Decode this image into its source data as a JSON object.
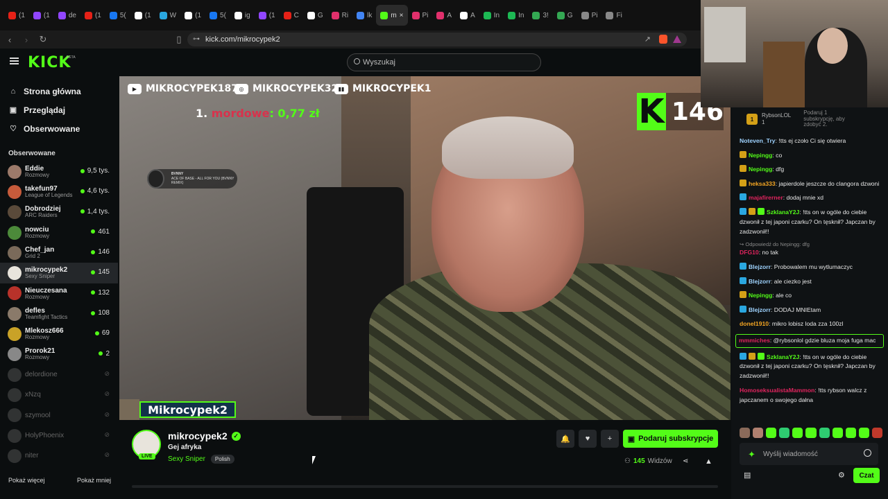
{
  "browser": {
    "tabs": [
      {
        "label": "(1",
        "color": "#e62117"
      },
      {
        "label": "(1",
        "color": "#9146ff"
      },
      {
        "label": "de",
        "color": "#9146ff"
      },
      {
        "label": "(1",
        "color": "#e62117"
      },
      {
        "label": "5(",
        "color": "#1877f2"
      },
      {
        "label": "(1",
        "color": "#ffffff"
      },
      {
        "label": "W",
        "color": "#2aa7e0"
      },
      {
        "label": "(1",
        "color": "#ffffff"
      },
      {
        "label": "5(",
        "color": "#1877f2"
      },
      {
        "label": "ig",
        "color": "#ffffff"
      },
      {
        "label": "(1",
        "color": "#9146ff"
      },
      {
        "label": "C",
        "color": "#e62117"
      },
      {
        "label": "G",
        "color": "#ffffff"
      },
      {
        "label": "Ri",
        "color": "#e1306c"
      },
      {
        "label": "lk",
        "color": "#4285f4"
      },
      {
        "label": "m",
        "color": "#53fc18",
        "active": true
      },
      {
        "label": "Pi",
        "color": "#e1306c"
      },
      {
        "label": "A",
        "color": "#e1306c"
      },
      {
        "label": "A",
        "color": "#ffffff"
      },
      {
        "label": "In",
        "color": "#1db954"
      },
      {
        "label": "In",
        "color": "#1db954"
      },
      {
        "label": "3!",
        "color": "#34a853"
      },
      {
        "label": "G",
        "color": "#34a853"
      },
      {
        "label": "Pi",
        "color": "#888888"
      },
      {
        "label": "Fi",
        "color": "#888888"
      }
    ],
    "close_glyph": "×",
    "url": "kick.com/mikrocypek2"
  },
  "header": {
    "logo": "KICK",
    "logo_beta": "BETA",
    "search_placeholder": "Wyszukaj"
  },
  "sidebar": {
    "nav": [
      {
        "label": "Strona główna",
        "icon": "home-icon",
        "glyph": "⌂"
      },
      {
        "label": "Przeglądaj",
        "icon": "browse-icon",
        "glyph": "▣"
      },
      {
        "label": "Obserwowane",
        "icon": "heart-icon",
        "glyph": "♡"
      }
    ],
    "follow_title": "Obserwowane",
    "channels": [
      {
        "name": "Eddie",
        "category": "Rozmowy",
        "viewers": "9,5 tys.",
        "color": "#9c7a6a",
        "live": true
      },
      {
        "name": "takefun97",
        "category": "League of Legends",
        "viewers": "4,6 tys.",
        "color": "#c65b3b",
        "live": true
      },
      {
        "name": "Dobrodziej",
        "category": "ARC Raiders",
        "viewers": "1,4 tys.",
        "color": "#5a4a3a",
        "live": true
      },
      {
        "name": "nowciu",
        "category": "Rozmowy",
        "viewers": "461",
        "color": "#4c8a3a",
        "live": true
      },
      {
        "name": "Chef_jan",
        "category": "Grid 2",
        "viewers": "146",
        "color": "#7a6a5a",
        "live": true
      },
      {
        "name": "mikrocypek2",
        "category": "Sexy Sniper",
        "viewers": "145",
        "color": "#e8e4dc",
        "live": true,
        "active": true
      },
      {
        "name": "Nieuczesana",
        "category": "Rozmowy",
        "viewers": "132",
        "color": "#b8322a",
        "live": true
      },
      {
        "name": "defles",
        "category": "Teamfight Tactics",
        "viewers": "108",
        "color": "#8a7a6a",
        "live": true
      },
      {
        "name": "Mlekosz666",
        "category": "Rozmowy",
        "viewers": "69",
        "color": "#c9a227",
        "live": true
      },
      {
        "name": "Prorok21",
        "category": "Rozmowy",
        "viewers": "2",
        "color": "#888888",
        "live": true
      },
      {
        "name": "delordione",
        "category": "",
        "viewers": "⊘",
        "color": "#777777",
        "live": false
      },
      {
        "name": "xNzq",
        "category": "",
        "viewers": "⊘",
        "color": "#777777",
        "live": false
      },
      {
        "name": "szymool",
        "category": "",
        "viewers": "⊘",
        "color": "#777777",
        "live": false
      },
      {
        "name": "HolyPhoenix",
        "category": "",
        "viewers": "⊘",
        "color": "#777777",
        "live": false
      },
      {
        "name": "niter",
        "category": "",
        "viewers": "⊘",
        "color": "#777777",
        "live": false
      }
    ],
    "show_more": "Pokaż więcej",
    "show_less": "Pokaż mniej"
  },
  "video": {
    "socials": [
      {
        "platform": "YouTube",
        "glyph": "▶",
        "handle": "MIKROCYPEK187"
      },
      {
        "platform": "Instagram",
        "glyph": "◎",
        "handle": "MIKROCYPEK32"
      },
      {
        "platform": "Twitch",
        "glyph": "▮▮",
        "handle": "MIKROCYPEK1"
      }
    ],
    "top_rank": "1.",
    "top_donor": "mordowe",
    "top_amount": ": 0,77 zł",
    "k_glyph": "K",
    "k_count": "146",
    "music_artist": "BVNNY",
    "music_track": "ACE OF BASE - ALL FOR YOU (BVNNY REMIX)",
    "overlay_name": "Mikrocypek2"
  },
  "stream_info": {
    "streamer": "mikrocypek2",
    "verified_glyph": "✓",
    "live_badge": "LIVE",
    "title": "Gej afryka",
    "category": "Sexy Sniper",
    "tag": "Polish",
    "bell_glyph": "🔔",
    "heart_glyph": "♥",
    "gift_glyph": "+",
    "subscribe_label": "Podaruj subskrypcje",
    "viewers_count": "145",
    "viewers_label": "Widzów",
    "share_glyph": "⋖",
    "report_glyph": "▲"
  },
  "chat": {
    "pinned_rank": "1",
    "pinned_user": "RybsonLOL",
    "pinned_count": "1",
    "pinned_desc": "Podaruj 1 subskrypcję, aby zdobyć 2.",
    "messages": [
      {
        "user": "Noteven_Try",
        "text": ": !tts ej czoło Ci się otwiera",
        "color": "#9fd3ff",
        "badges": []
      },
      {
        "user": "Nepingg",
        "text": ": co",
        "color": "#53fc18",
        "badges": [
          "#d4a017"
        ]
      },
      {
        "user": "Nepingg",
        "text": ": dfg",
        "color": "#53fc18",
        "badges": [
          "#d4a017"
        ]
      },
      {
        "user": "heksa333",
        "text": ": japierdole jeszcze do clangora dzwoni",
        "color": "#f5a623",
        "badges": [
          "#d4a017"
        ]
      },
      {
        "user": "majafirerner",
        "text": ": dodaj mnie xd",
        "color": "#e0245e",
        "badges": [
          "#2aa7e0"
        ]
      },
      {
        "user": "SzklanaY2J",
        "text": ": !tts on w ogóle do ciebie dzwonił z tej japoni czarku? On tęsknił? Japczan by zadzwonił!!",
        "color": "#53fc18",
        "badges": [
          "#2aa7e0",
          "#d4a017",
          "#53fc18"
        ]
      },
      {
        "user": "DFG10",
        "text": ": no tak",
        "color": "#e0245e",
        "badges": [],
        "reply": "↪ Odpowiedź do Nepingg: dfg"
      },
      {
        "user": "Blejzorr",
        "text": ": Probowalem mu wytlumaczyc",
        "color": "#9fd3ff",
        "badges": [
          "#2aa7e0"
        ]
      },
      {
        "user": "Blejzorr",
        "text": ": ale ciezko jest",
        "color": "#9fd3ff",
        "badges": [
          "#2aa7e0"
        ]
      },
      {
        "user": "Nepingg",
        "text": ": ale co",
        "color": "#53fc18",
        "badges": [
          "#d4a017"
        ]
      },
      {
        "user": "Blejzorr",
        "text": ": DODAJ MNIEtam",
        "color": "#9fd3ff",
        "badges": [
          "#2aa7e0"
        ]
      },
      {
        "user": "donel1910",
        "text": ": mikro lobisz loda zza 100zl",
        "color": "#f5a623",
        "badges": []
      },
      {
        "user": "mmmiches",
        "text": ": @rybsonlol gdzie bluza moja fuga mac",
        "color": "#e0245e",
        "badges": [],
        "highlight": true
      },
      {
        "user": "SzklanaY2J",
        "text": ": !tts on w ogóle do ciebie dzwonił z tej japoni czarku? On tęsknił? Japczan by zadzwonił!!",
        "color": "#53fc18",
        "badges": [
          "#2aa7e0",
          "#d4a017",
          "#53fc18"
        ]
      },
      {
        "user": "HomoseksualistaMammon",
        "text": ": !tts rybson walcz z japczanem o swojego dałna",
        "color": "#e0245e",
        "badges": []
      }
    ],
    "emotes": [
      "#8a6a5a",
      "#b08070",
      "#53fc18",
      "#2ecc71",
      "#53fc18",
      "#53fc18",
      "#2ecc71",
      "#53fc18",
      "#53fc18",
      "#53fc18",
      "#c0392b"
    ],
    "input_placeholder": "Wyślij wiadomość",
    "spark_glyph": "✦",
    "store_glyph": "▤",
    "gear_glyph": "⚙",
    "send_label": "Czat"
  }
}
